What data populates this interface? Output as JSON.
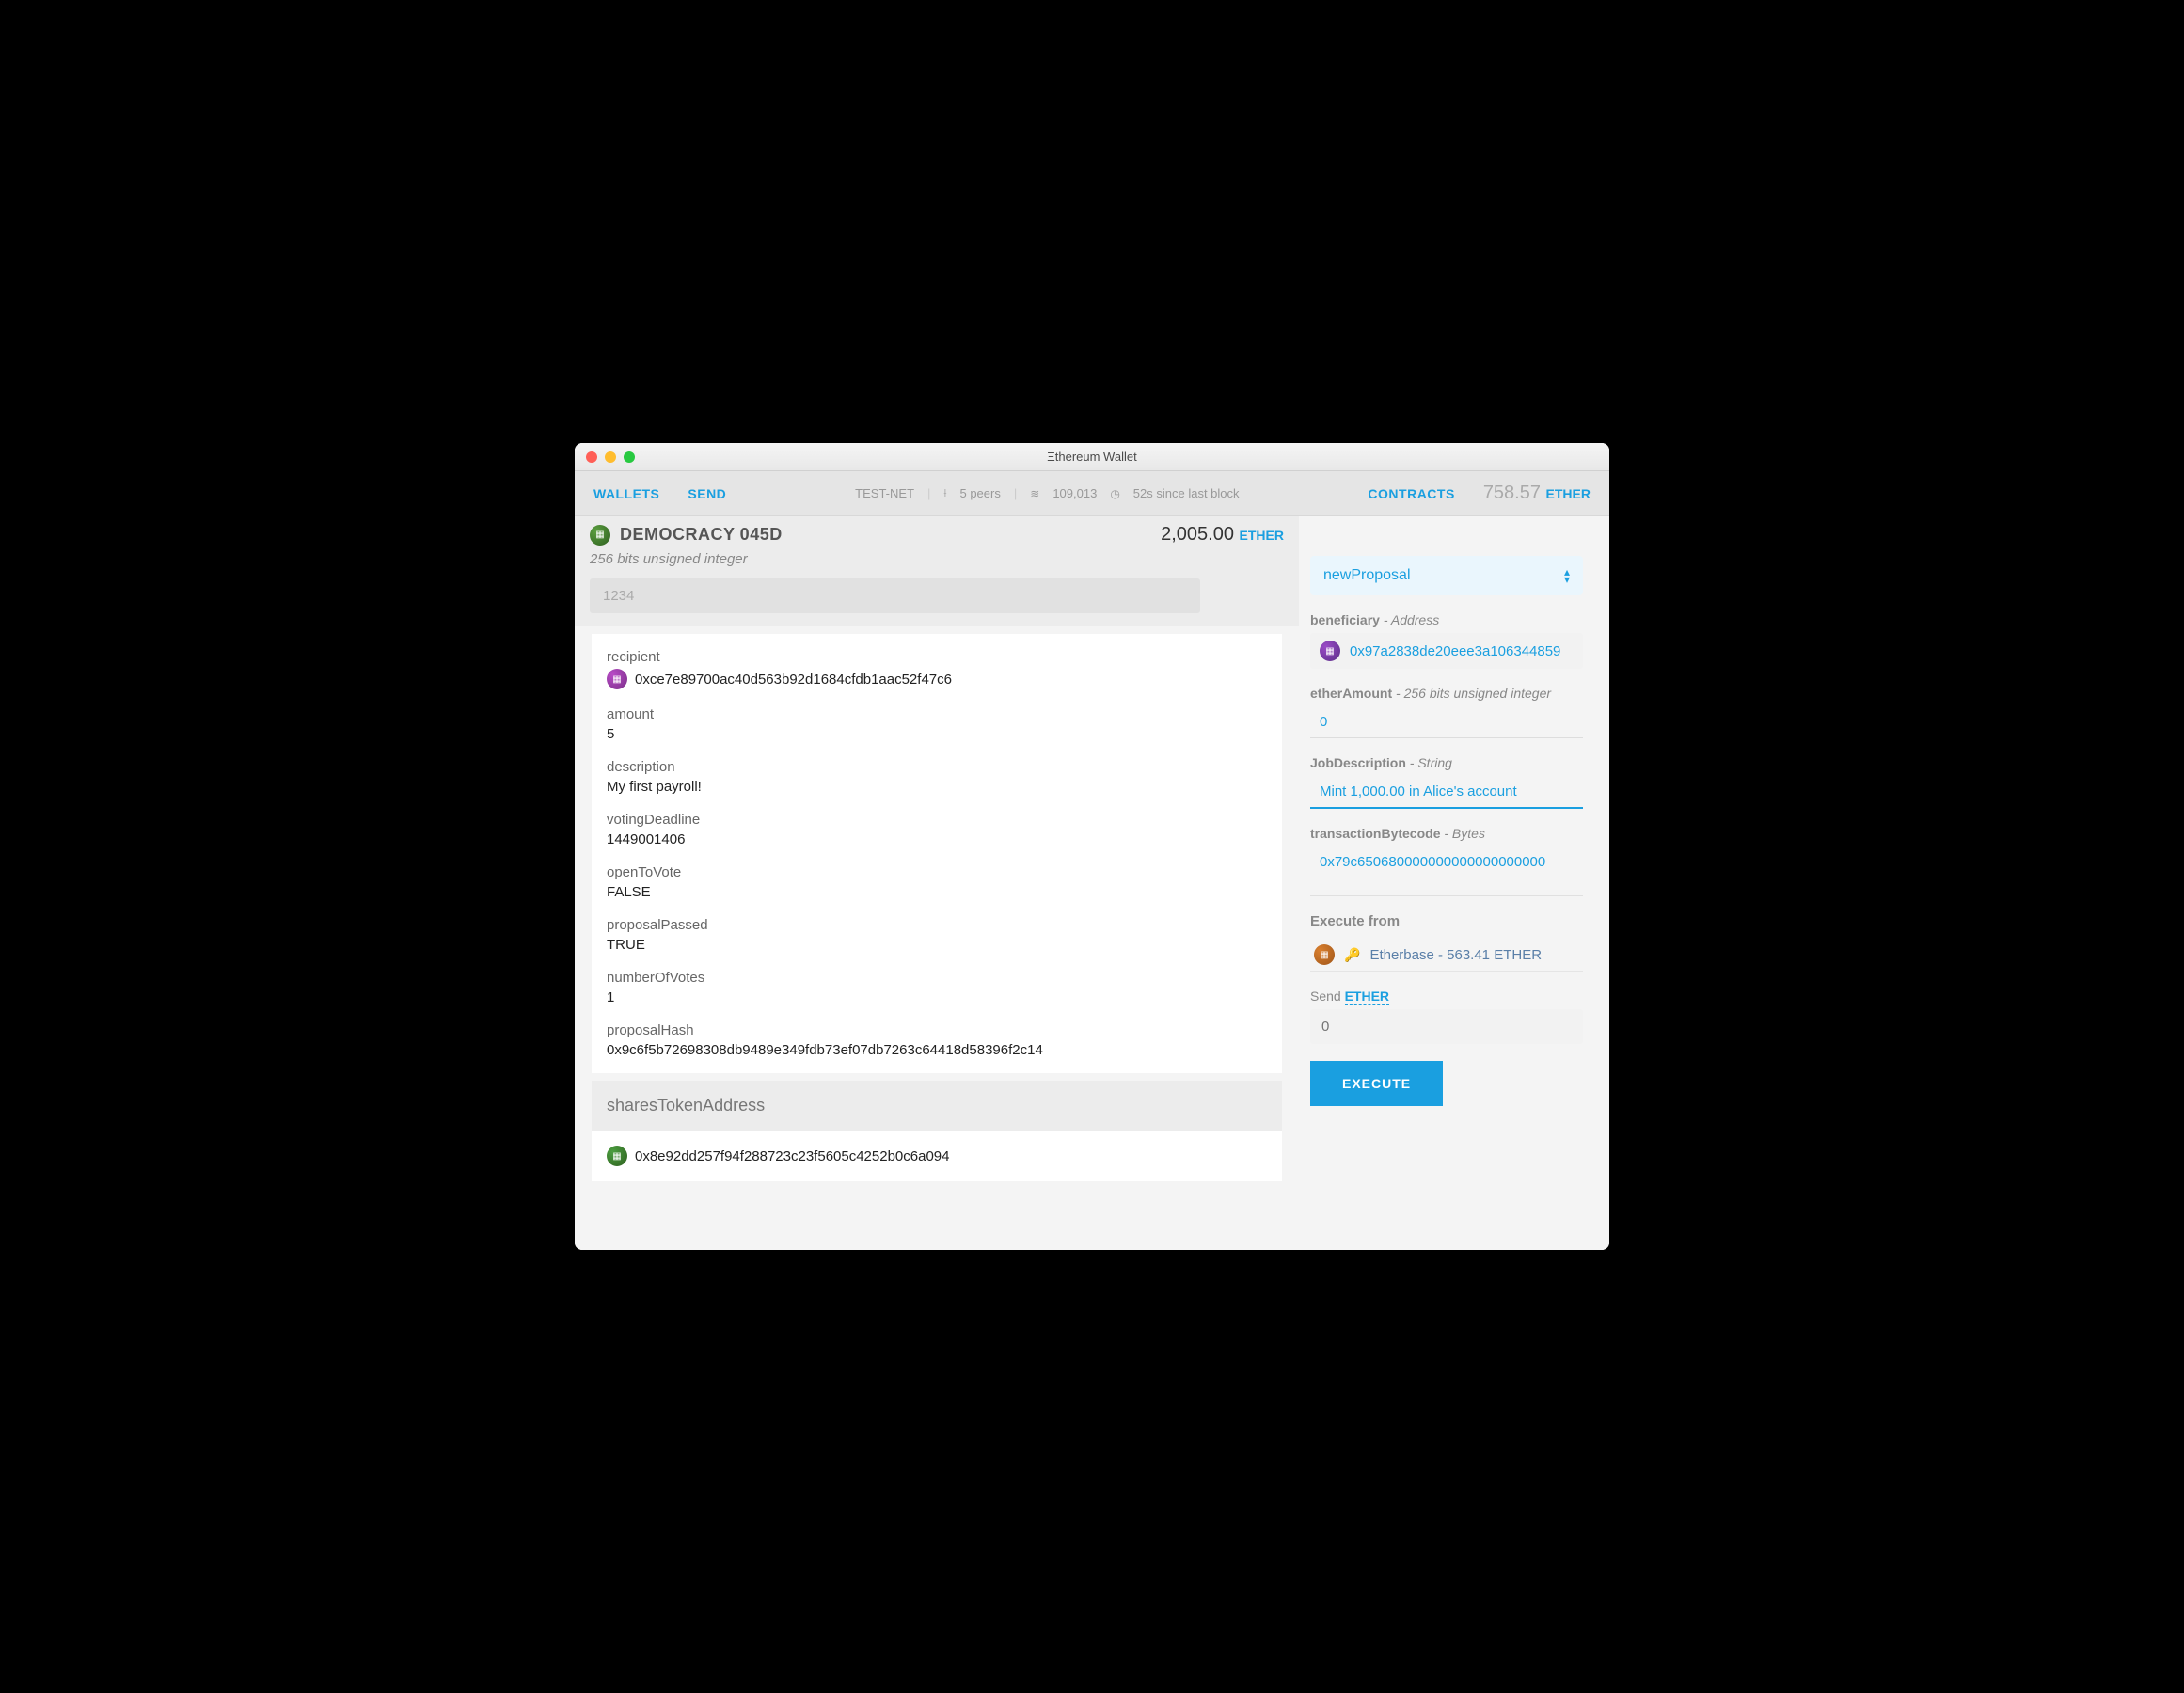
{
  "window": {
    "title": "Ξthereum Wallet"
  },
  "nav": {
    "wallets": "WALLETS",
    "send": "SEND",
    "testnet": "TEST-NET",
    "peers": "5 peers",
    "blocks": "109,013",
    "lastblock": "52s since last block",
    "contracts": "CONTRACTS",
    "balance": "758.57",
    "balance_unit": "ETHER"
  },
  "contract": {
    "name": "DEMOCRACY 045D",
    "balance": "2,005.00",
    "balance_unit": "ETHER",
    "int_label": "256 bits unsigned integer",
    "int_placeholder": "1234",
    "fields": {
      "recipient_label": "recipient",
      "recipient_addr": "0xce7e89700ac40d563b92d1684cfdb1aac52f47c6",
      "amount_label": "amount",
      "amount_value": "5",
      "description_label": "description",
      "description_value": "My first payroll!",
      "votingDeadline_label": "votingDeadline",
      "votingDeadline_value": "1449001406",
      "openToVote_label": "openToVote",
      "openToVote_value": "FALSE",
      "proposalPassed_label": "proposalPassed",
      "proposalPassed_value": "TRUE",
      "numberOfVotes_label": "numberOfVotes",
      "numberOfVotes_value": "1",
      "proposalHash_label": "proposalHash",
      "proposalHash_value": "0x9c6f5b72698308db9489e349fdb73ef07db7263c64418d58396f2c14"
    },
    "shares_label": "sharesTokenAddress",
    "shares_addr": "0x8e92dd257f94f288723c23f5605c4252b0c6a094"
  },
  "form": {
    "function": "newProposal",
    "beneficiary_label": "beneficiary",
    "beneficiary_type": " - Address",
    "beneficiary_value": "0x97a2838de20eee3a106344859",
    "etherAmount_label": "etherAmount",
    "etherAmount_type": " - 256 bits unsigned integer",
    "etherAmount_value": "0",
    "jobDescription_label": "JobDescription",
    "jobDescription_type": " - String",
    "jobDescription_value": "Mint 1,000.00 in Alice's account",
    "txBytecode_label": "transactionBytecode",
    "txBytecode_type": " - Bytes",
    "txBytecode_value": "0x79c650680000000000000000000",
    "execute_from_label": "Execute from",
    "execute_from_value": "Etherbase - 563.41 ETHER",
    "send_label": "Send ",
    "send_unit": "ETHER",
    "send_placeholder": "0",
    "execute_btn": "EXECUTE"
  }
}
